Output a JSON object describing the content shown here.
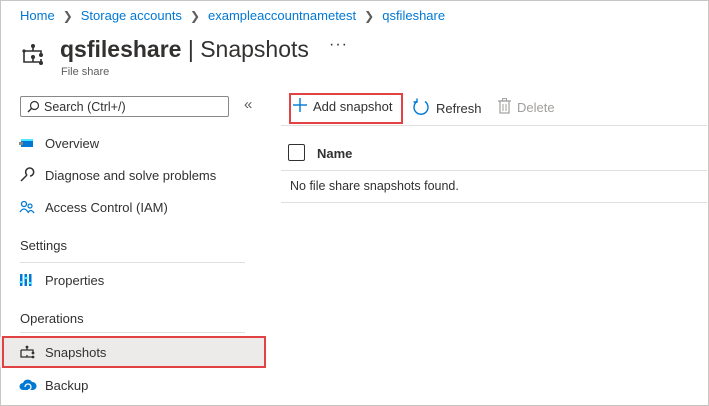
{
  "breadcrumb": [
    "Home",
    "Storage accounts",
    "exampleaccountnametest",
    "qsfileshare"
  ],
  "header": {
    "title_bold": "qsfileshare",
    "title_rest": " | Snapshots",
    "more": "···",
    "subtitle": "File share",
    "icon": "file-share-icon"
  },
  "search": {
    "placeholder": "Search (Ctrl+/)",
    "collapse": "«"
  },
  "sidebar": {
    "items": [
      {
        "label": "Overview",
        "icon": "overview-icon"
      },
      {
        "label": "Diagnose and solve problems",
        "icon": "wrench-icon"
      },
      {
        "label": "Access Control (IAM)",
        "icon": "people-icon"
      }
    ],
    "settings_title": "Settings",
    "settings_items": [
      {
        "label": "Properties",
        "icon": "properties-icon"
      }
    ],
    "operations_title": "Operations",
    "operations_items": [
      {
        "label": "Snapshots",
        "icon": "snapshot-icon",
        "active": true
      },
      {
        "label": "Backup",
        "icon": "cloud-backup-icon"
      }
    ]
  },
  "toolbar": {
    "add_snapshot": "Add snapshot",
    "refresh": "Refresh",
    "delete": "Delete"
  },
  "table": {
    "columns": [
      "Name"
    ],
    "empty_message": "No file share snapshots found."
  },
  "colors": {
    "link": "#0078d4",
    "highlight": "#e34245",
    "active_bg": "#edebe9"
  }
}
